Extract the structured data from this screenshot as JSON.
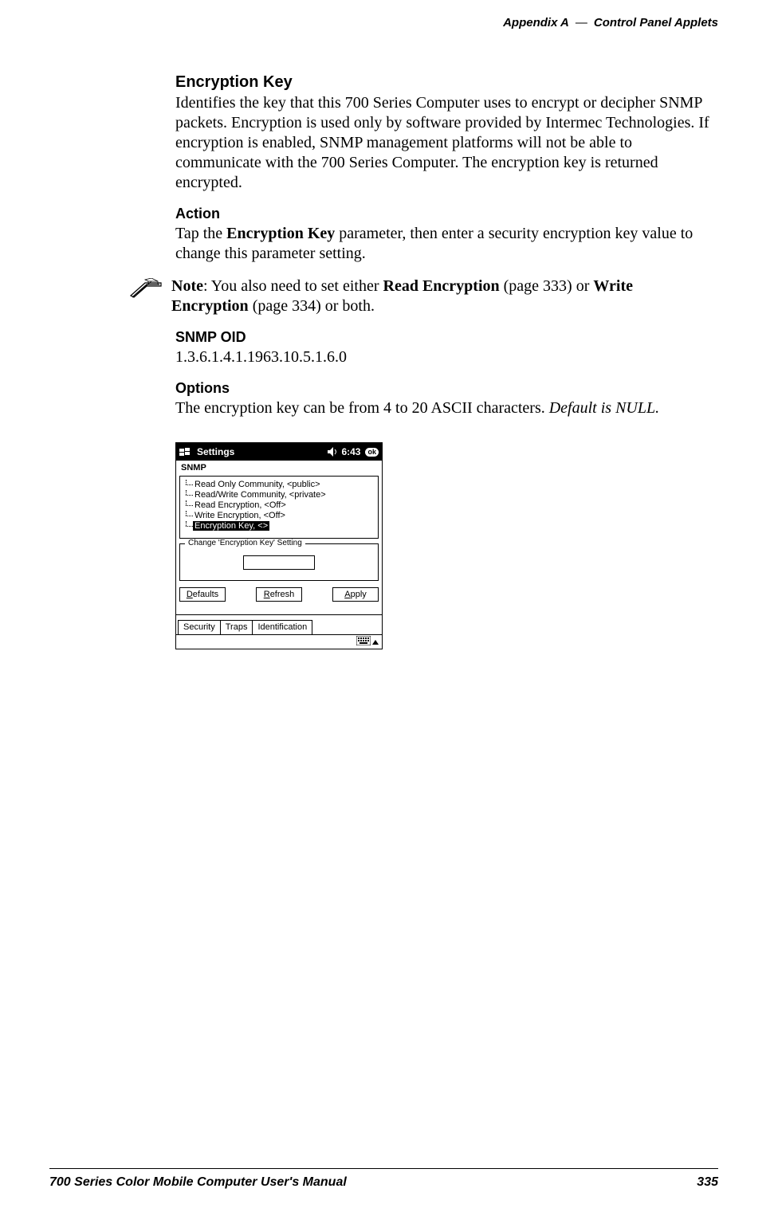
{
  "header": {
    "left": "Appendix A",
    "right": "Control Panel Applets"
  },
  "sections": {
    "h1": "Encryption Key",
    "p1": "Identifies the key that this 700 Series Computer uses to encrypt or decipher SNMP packets. Encryption is used only by software provided by Intermec Technologies. If encryption is enabled, SNMP management platforms will not be able to communicate with the 700 Series Computer. The encryption key is returned encrypted.",
    "h2": "Action",
    "p2a": "Tap the ",
    "p2b": "Encryption Key",
    "p2c": " parameter, then enter a security encryption key value to change this parameter setting.",
    "note_label": "Note",
    "note_a": ": You also need to set either ",
    "note_b": "Read Encryption",
    "note_c": " (page 333) or ",
    "note_d": "Write Encryption",
    "note_e": " (page 334) or both.",
    "h3": "SNMP OID",
    "p3": "1.3.6.1.4.1.1963.10.5.1.6.0",
    "h4": "Options",
    "p4a": "The encryption key can be from 4 to 20 ASCII characters. ",
    "p4b": "Default is NULL."
  },
  "screenshot": {
    "title": "Settings",
    "time": "6:43",
    "ok": "ok",
    "app": "SNMP",
    "tree": [
      "Read Only Community, <public>",
      "Read/Write Community, <private>",
      "Read Encryption, <Off>",
      "Write Encryption, <Off>",
      "Encryption Key, <>"
    ],
    "group_legend": "Change 'Encryption Key' Setting",
    "buttons": {
      "defaults": "efaults",
      "defaults_u": "D",
      "refresh": "efresh",
      "refresh_u": "R",
      "apply": "pply",
      "apply_u": "A"
    },
    "tabs": [
      "Security",
      "Traps",
      "Identification"
    ]
  },
  "footer": {
    "left": "700 Series Color Mobile Computer User's Manual",
    "right": "335"
  }
}
